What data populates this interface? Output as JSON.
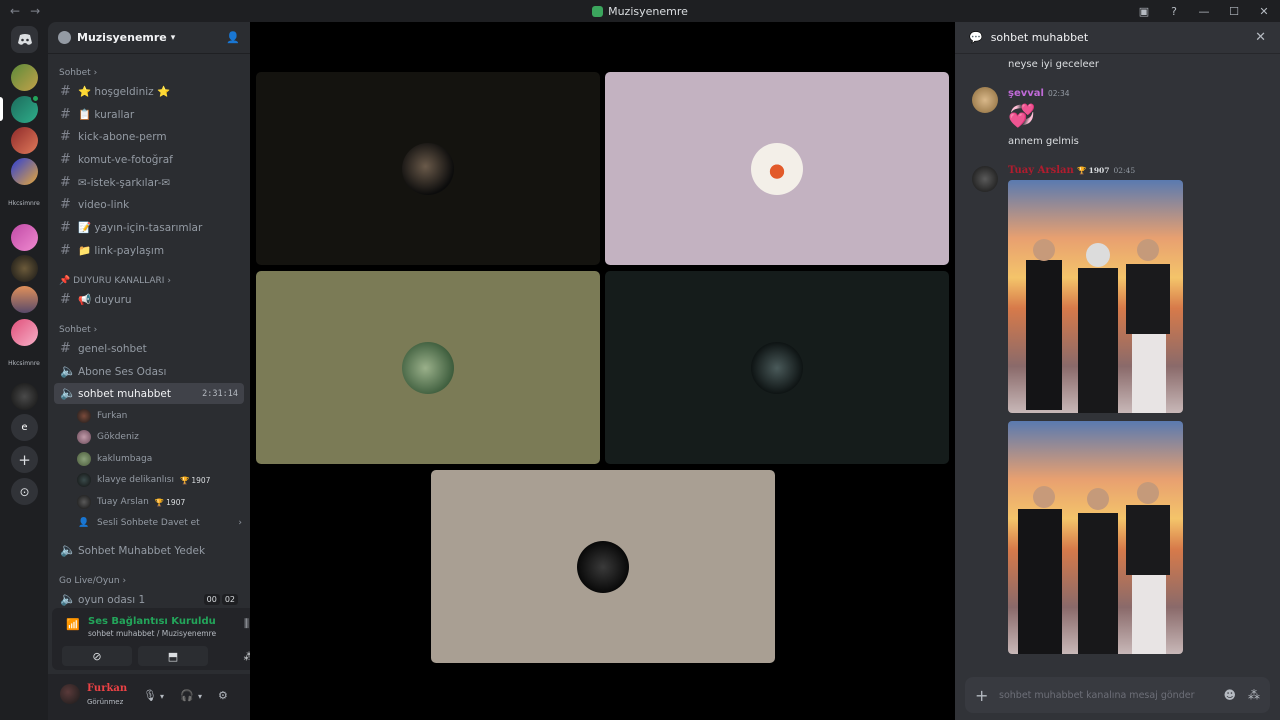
{
  "window": {
    "title": "Muzisyenemre"
  },
  "rail": {
    "home_icon": "discord-icon",
    "labels": [
      "Hkcsimnre",
      "Hkcsimnre"
    ],
    "text_guild": "e"
  },
  "server": {
    "name": "Muzisyenemre"
  },
  "categories": {
    "sohbet1": "Sohbet",
    "duyuru": "📌 DUYURU KANALLARI",
    "sohbet2": "Sohbet",
    "golive": "Go Live/Oyun"
  },
  "channels": [
    {
      "name": "⭐ hoşgeldiniz ⭐",
      "type": "text"
    },
    {
      "name": "📋 kurallar",
      "type": "text"
    },
    {
      "name": "kick-abone-perm",
      "type": "text"
    },
    {
      "name": "komut-ve-fotoğraf",
      "type": "text"
    },
    {
      "name": "✉-istek-şarkılar-✉",
      "type": "text"
    },
    {
      "name": "video-link",
      "type": "text"
    },
    {
      "name": "📝 yayın-için-tasarımlar",
      "type": "text"
    },
    {
      "name": "📁 link-paylaşım",
      "type": "text"
    },
    {
      "name": "📢 duyuru",
      "type": "text"
    },
    {
      "name": "genel-sohbet",
      "type": "text"
    },
    {
      "name": "Abone Ses Odası",
      "type": "voice"
    },
    {
      "name": "sohbet muhabbet",
      "type": "voice",
      "timer": "2:31:14"
    },
    {
      "name": "Sohbet Muhabbet Yedek",
      "type": "voice"
    },
    {
      "name": "oyun odası 1",
      "type": "voice",
      "counts": [
        "00",
        "02"
      ]
    }
  ],
  "voice_users": [
    {
      "name": "Furkan"
    },
    {
      "name": "Gökdeniz"
    },
    {
      "name": "kaklumbaga"
    },
    {
      "name": "klavye delikanlısı",
      "tag": "1907"
    },
    {
      "name": "Tuay Arslan",
      "tag": "1907"
    },
    {
      "name": "Sesli Sohbete Davet et"
    }
  ],
  "voice_panel": {
    "status": "Ses Bağlantısı Kuruldu",
    "sub": "sohbet muhabbet / Muzisyenemre"
  },
  "user": {
    "name": "Furkan",
    "status": "Görünmez"
  },
  "tiles": {
    "colors": [
      "#14130f",
      "#c3b2c1",
      "#7b7b56",
      "#151c1b",
      "#a99f93"
    ]
  },
  "chat": {
    "channel": "sohbet muhabbet",
    "messages": [
      {
        "text": "neyse iyi geceleer"
      },
      {
        "author": "şevval",
        "time": "02:34",
        "color": "#c06ad8",
        "emoji": "💞",
        "text": "annem gelmis"
      },
      {
        "author": "Tuay Arslan",
        "time": "02:45",
        "color": "#b01c2e",
        "tag": "1907"
      }
    ],
    "placeholder": "sohbet muhabbet kanalına mesaj gönder"
  }
}
